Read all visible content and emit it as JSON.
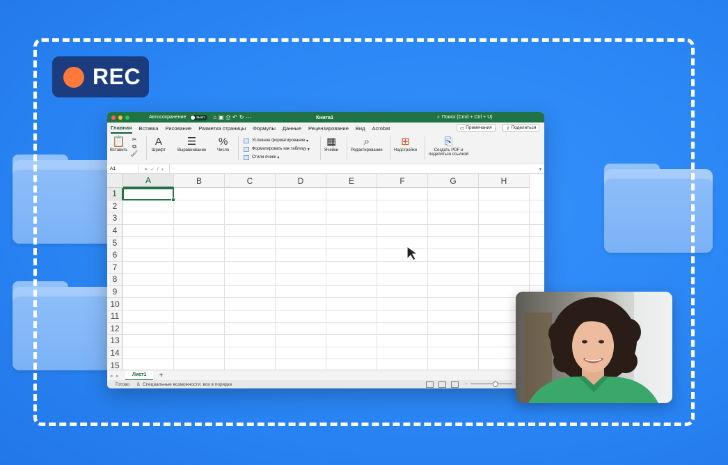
{
  "recording": {
    "label": "REC",
    "accent": "#ff7a3a"
  },
  "excel": {
    "autosave_label": "Автосохранение",
    "autosave_state": "выкл.",
    "workbook_title": "Книга1",
    "search_placeholder": "Поиск (Cmd + Ctrl + U)",
    "brand_color": "#217346",
    "tabs": [
      "Главная",
      "Вставка",
      "Рисование",
      "Разметка страницы",
      "Формулы",
      "Данные",
      "Рецензирование",
      "Вид",
      "Acrobat"
    ],
    "comments_button": "Примечания",
    "share_button": "Поделиться",
    "ribbon": {
      "paste": "Вставить",
      "font": "Шрифт",
      "alignment": "Выравнивание",
      "number": "Число",
      "conditional_formatting": "Условное форматирование",
      "format_as_table": "Форматировать как таблицу",
      "cell_styles": "Стили ячеек",
      "cells": "Ячейки",
      "editing": "Редактирование",
      "addins": "Надстройки",
      "create_pdf_line1": "Создать PDF и",
      "create_pdf_line2": "поделиться ссылкой"
    },
    "name_box": "A1",
    "fx_label": "fx",
    "columns": [
      "A",
      "B",
      "C",
      "D",
      "E",
      "F",
      "G",
      "H"
    ],
    "rows": [
      "1",
      "2",
      "3",
      "4",
      "5",
      "6",
      "7",
      "8",
      "9",
      "10",
      "11",
      "12",
      "13",
      "14",
      "15"
    ],
    "sheet_name": "Лист1",
    "add_sheet": "+",
    "status_ready": "Готово",
    "status_accessibility": "Специальные возможности: все в порядке",
    "zoom_minus": "−",
    "zoom_plus": "+"
  }
}
